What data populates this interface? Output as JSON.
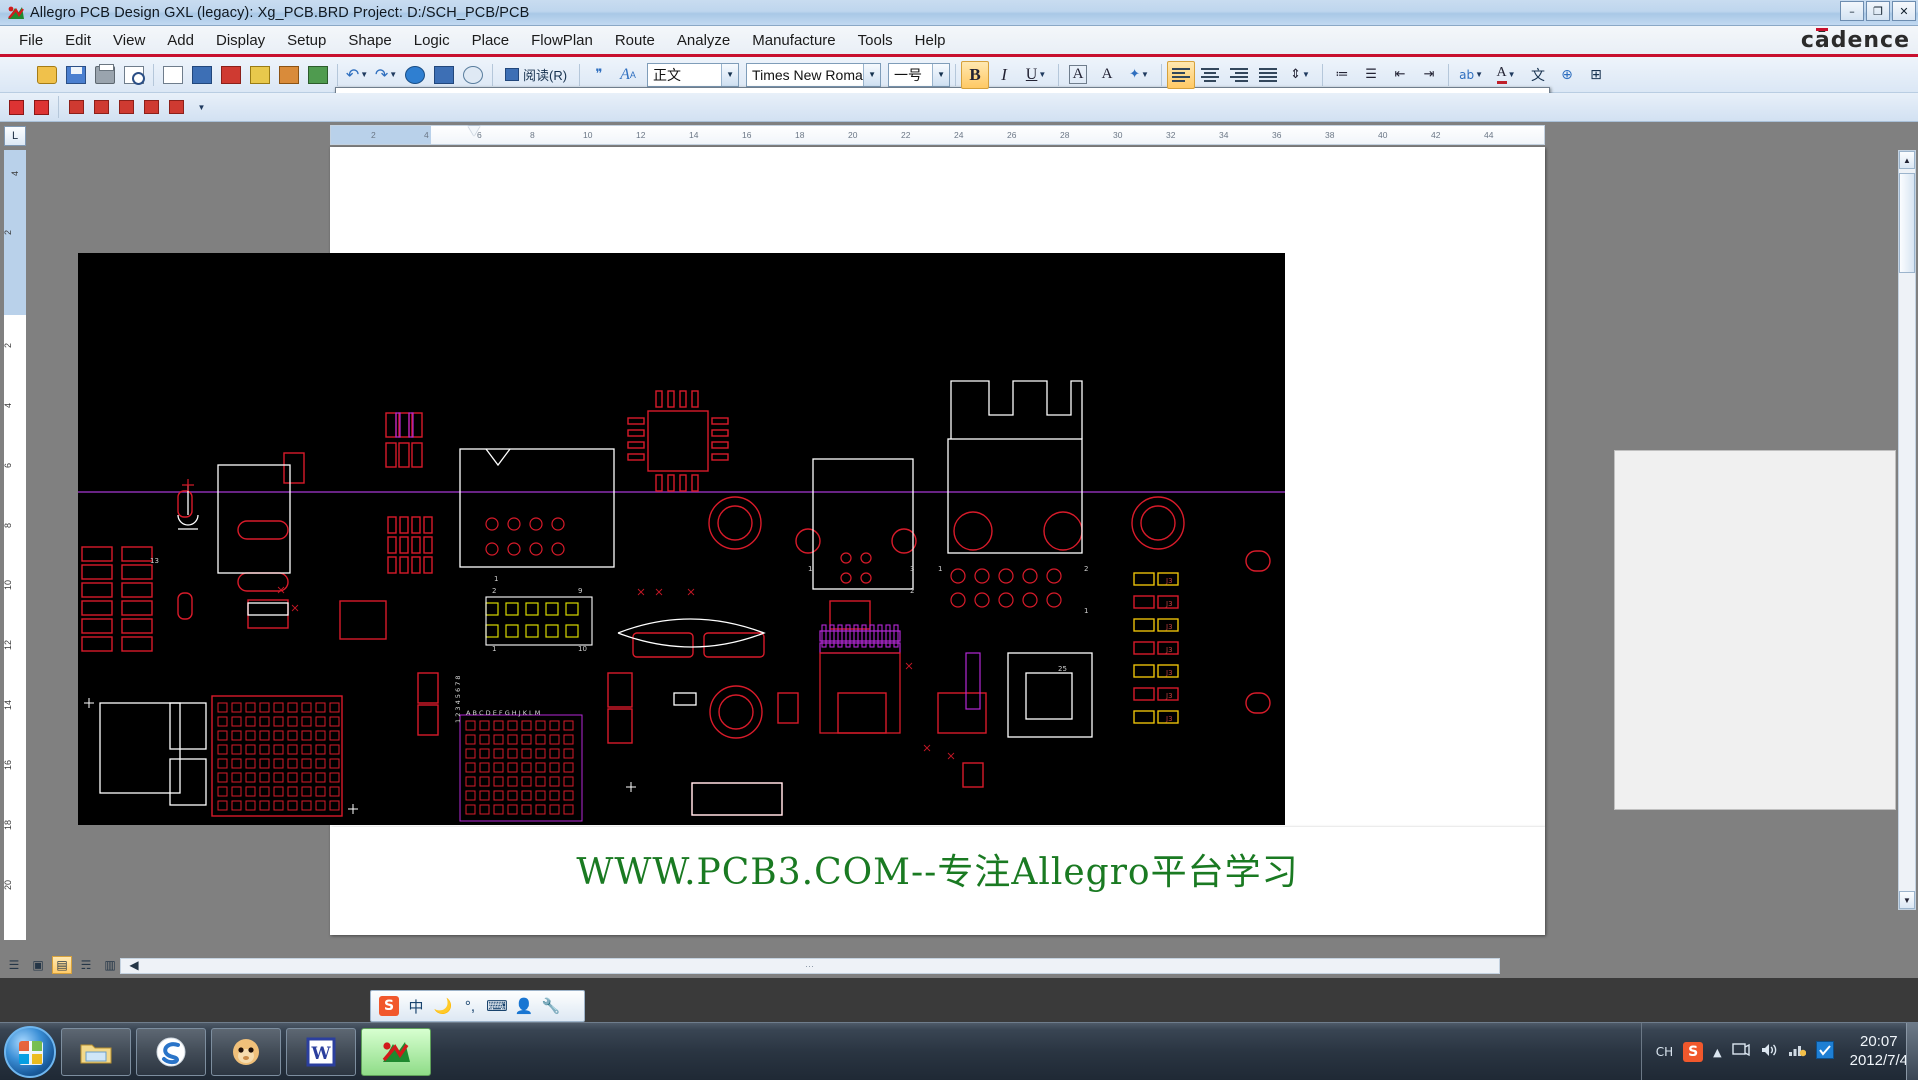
{
  "window": {
    "title": "Allegro PCB Design GXL (legacy): Xg_PCB.BRD  Project: D:/SCH_PCB/PCB",
    "app_icon": "allegro-icon",
    "minimize": "–",
    "restore": "❐",
    "close": "✕",
    "brand": "cādence"
  },
  "menu": {
    "items": [
      {
        "label": "File"
      },
      {
        "label": "Edit"
      },
      {
        "label": "View"
      },
      {
        "label": "Add"
      },
      {
        "label": "Display"
      },
      {
        "label": "Setup"
      },
      {
        "label": "Shape"
      },
      {
        "label": "Logic"
      },
      {
        "label": "Place"
      },
      {
        "label": "FlowPlan"
      },
      {
        "label": "Route"
      },
      {
        "label": "Analyze"
      },
      {
        "label": "Manufacture"
      },
      {
        "label": "Tools"
      },
      {
        "label": "Help"
      }
    ]
  },
  "toolbar": {
    "read_mode_label": "阅读(R)",
    "style_value": "正文",
    "font_value": "Times New Roman",
    "size_value": "一号",
    "bold_label": "B",
    "italic_label": "I",
    "underline_label": "U",
    "clear_format_label": "A",
    "text_effect_label": "A",
    "highlight_label": "A",
    "icons": [
      "new-document-icon",
      "open-folder-icon",
      "save-icon",
      "print-icon",
      "print-preview-icon",
      "spellcheck-icon",
      "cut-icon",
      "copy-icon",
      "paste-icon",
      "format-painter-icon",
      "undo-icon",
      "redo-icon",
      "insert-hyperlink-icon",
      "insert-table-icon",
      "help-icon",
      "reading-layout-icon",
      "show-formatting-icon",
      "grow-font-icon"
    ],
    "row2_icons": [
      "pdf-export-icon",
      "pdf-send-icon",
      "redbox-icon",
      "redbox-2-icon",
      "redbox-3-icon",
      "redbox-4-icon",
      "redbox-5-icon"
    ],
    "align_icons": [
      "align-left-icon",
      "align-center-icon",
      "align-right-icon",
      "align-justify-icon",
      "line-spacing-icon"
    ],
    "list_icons": [
      "numbered-list-icon",
      "bulleted-list-icon",
      "decrease-indent-icon",
      "increase-indent-icon"
    ],
    "right_icons": [
      "text-highlight-icon",
      "font-color-icon",
      "chinese-layout-icon",
      "web-tools-icon",
      "borders-icon"
    ]
  },
  "document": {
    "tab_corner_label": "L",
    "vertical_ruler_ticks": [
      "4",
      "2",
      "",
      "2",
      "4",
      "6",
      "8",
      "10",
      "12",
      "14",
      "16",
      "18",
      "20"
    ],
    "horizontal_ruler_numbers": [
      "2",
      "4",
      "6",
      "8",
      "10",
      "12",
      "14",
      "16",
      "18",
      "20",
      "22",
      "24",
      "26",
      "28",
      "30",
      "32",
      "34",
      "36",
      "38",
      "40",
      "42",
      "44"
    ],
    "caption_text": "WWW.PCB3.COM--专注Allegro平台学习",
    "scroll_handle_label": "⋯",
    "view_buttons": [
      "print-layout-view-icon",
      "full-screen-reading-view-icon",
      "web-layout-view-icon",
      "outline-view-icon",
      "draft-view-icon",
      "select-browse-object-icon"
    ]
  },
  "ime": {
    "sogou_label": "S",
    "mode_label": "中",
    "icons": [
      "moon-icon",
      "punctuation-icon",
      "soft-keyboard-icon",
      "user-icon",
      "wrench-icon"
    ]
  },
  "taskbar": {
    "start_label": "start-orb",
    "buttons": [
      {
        "name": "windows-explorer",
        "icon": "folder-icon"
      },
      {
        "name": "sogou-browser",
        "icon": "sogou-icon"
      },
      {
        "name": "qq-messenger",
        "icon": "monkey-icon"
      },
      {
        "name": "microsoft-word",
        "icon": "word-icon"
      },
      {
        "name": "allegro-pcb-design",
        "icon": "allegro-icon"
      }
    ],
    "tray": {
      "language_label": "CH",
      "ime_label": "S",
      "icons": [
        "show-hidden-icons-arrow",
        "network-icon",
        "volume-icon",
        "signal-icon",
        "update-icon"
      ],
      "time": "20:07",
      "date": "2012/7/4"
    }
  },
  "pcb": {
    "background": "#000000",
    "trace_colors": [
      "#d81b2a",
      "#ffffff",
      "#b429d6",
      "#d8d800",
      "#00c8c8"
    ],
    "guide_line_color": "#7a2fa0"
  }
}
